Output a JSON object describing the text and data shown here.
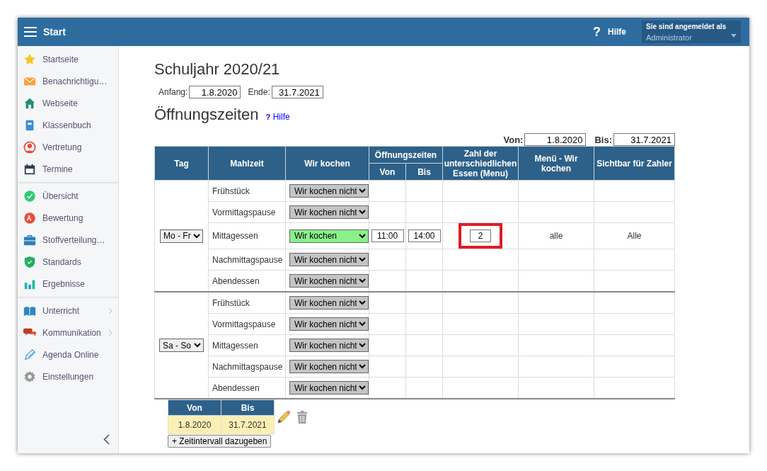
{
  "header": {
    "menu_title": "Start",
    "help": {
      "icon": "?",
      "label": "Hilfe"
    },
    "user": {
      "label": "Sie sind angemeldet als",
      "name": "Administrator"
    }
  },
  "sidebar": {
    "groups": [
      {
        "items": [
          {
            "label": "Startseite",
            "has_submenu": false
          },
          {
            "label": "Benachrichtigu…",
            "has_submenu": false
          },
          {
            "label": "Webseite",
            "has_submenu": false
          },
          {
            "label": "Klassenbuch",
            "has_submenu": false
          },
          {
            "label": "Vertretung",
            "has_submenu": false
          },
          {
            "label": "Termine",
            "has_submenu": false
          }
        ]
      },
      {
        "items": [
          {
            "label": "Übersicht",
            "has_submenu": false
          },
          {
            "label": "Bewertung",
            "has_submenu": false
          },
          {
            "label": "Stoffverteilung…",
            "has_submenu": false
          },
          {
            "label": "Standards",
            "has_submenu": false
          },
          {
            "label": "Ergebnisse",
            "has_submenu": false
          }
        ]
      },
      {
        "items": [
          {
            "label": "Unterricht",
            "has_submenu": true
          },
          {
            "label": "Kommunikation",
            "has_submenu": true
          },
          {
            "label": "Agenda Online",
            "has_submenu": false
          },
          {
            "label": "Einstellungen",
            "has_submenu": false
          }
        ]
      }
    ]
  },
  "school_year": {
    "title": "Schuljahr 2020/21",
    "start_label": "Anfang:",
    "start_value": "1.8.2020",
    "end_label": "Ende:",
    "end_value": "31.7.2021"
  },
  "opening_hours": {
    "title": "Öffnungszeiten",
    "help_icon": "?",
    "help_link": "Hilfe",
    "range": {
      "from_label": "Von:",
      "from_value": "1.8.2020",
      "to_label": "Bis:",
      "to_value": "31.7.2021"
    },
    "columns": {
      "day": "Tag",
      "meal": "Mahlzeit",
      "cooking": "Wir kochen",
      "hours": "Öffnungszeiten",
      "from": "Von",
      "to": "Bis",
      "count": "Zahl der unterschiedlichen Essen (Menu)",
      "menu": "Menü - Wir kochen",
      "visible": "Sichtbar für Zahler"
    },
    "groups": [
      {
        "days": "Mo - Fr",
        "meals": [
          {
            "meal": "Frühstück",
            "cooking": "Wir kochen nicht",
            "active": false
          },
          {
            "meal": "Vormittagspause",
            "cooking": "Wir kochen nicht",
            "active": false
          },
          {
            "meal": "Mittagessen",
            "cooking": "Wir kochen",
            "active": true,
            "from": "11:00",
            "to": "14:00",
            "count": "2",
            "count_highlighted": true,
            "menu": "alle",
            "visible": "Alle"
          },
          {
            "meal": "Nachmittagspause",
            "cooking": "Wir kochen nicht",
            "active": false
          },
          {
            "meal": "Abendessen",
            "cooking": "Wir kochen nicht",
            "active": false
          }
        ]
      },
      {
        "days": "Sa - So",
        "meals": [
          {
            "meal": "Frühstück",
            "cooking": "Wir kochen nicht",
            "active": false
          },
          {
            "meal": "Vormittagspause",
            "cooking": "Wir kochen nicht",
            "active": false
          },
          {
            "meal": "Mittagessen",
            "cooking": "Wir kochen nicht",
            "active": false
          },
          {
            "meal": "Nachmittagspause",
            "cooking": "Wir kochen nicht",
            "active": false
          },
          {
            "meal": "Abendessen",
            "cooking": "Wir kochen nicht",
            "active": false
          }
        ]
      }
    ]
  },
  "intervals": {
    "columns": [
      "Von",
      "Bis"
    ],
    "rows": [
      {
        "from": "1.8.2020",
        "to": "31.7.2021",
        "selected": true
      }
    ],
    "add_button": "+ Zeitintervall dazugeben"
  }
}
